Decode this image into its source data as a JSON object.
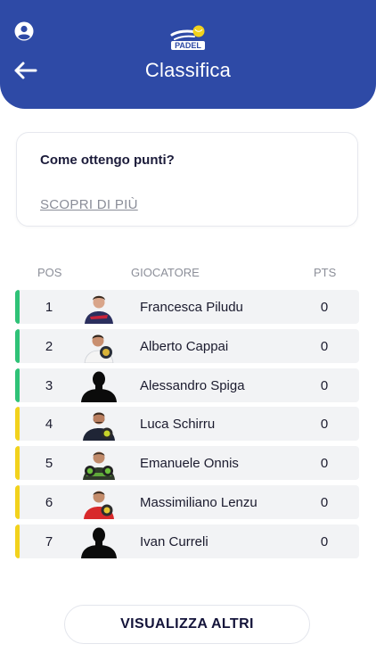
{
  "header": {
    "title": "Classifica",
    "logo_text": "PADEL",
    "icons": {
      "profile": "account-circle-icon",
      "back": "arrow-left-icon"
    },
    "color": "#2e4aa6"
  },
  "info_card": {
    "title": "Come ottengo punti?",
    "link": "SCOPRI DI PIÙ"
  },
  "table": {
    "columns": {
      "pos": "POS",
      "player": "GIOCATORE",
      "pts": "PTS"
    },
    "rows": [
      {
        "pos": "1",
        "name": "Francesca Piludu",
        "pts": "0",
        "stripe": "#2fc277",
        "avatar": "photo"
      },
      {
        "pos": "2",
        "name": "Alberto Cappai",
        "pts": "0",
        "stripe": "#2fc277",
        "avatar": "photo"
      },
      {
        "pos": "3",
        "name": "Alessandro Spiga",
        "pts": "0",
        "stripe": "#2fc277",
        "avatar": "silhouette"
      },
      {
        "pos": "4",
        "name": "Luca Schirru",
        "pts": "0",
        "stripe": "#f2d21c",
        "avatar": "photo"
      },
      {
        "pos": "5",
        "name": "Emanuele Onnis",
        "pts": "0",
        "stripe": "#f2d21c",
        "avatar": "photo"
      },
      {
        "pos": "6",
        "name": "Massimiliano Lenzu",
        "pts": "0",
        "stripe": "#f2d21c",
        "avatar": "photo"
      },
      {
        "pos": "7",
        "name": "Ivan Curreli",
        "pts": "0",
        "stripe": "#f2d21c",
        "avatar": "silhouette"
      }
    ]
  },
  "footer": {
    "more_label": "VISUALIZZA ALTRI"
  }
}
